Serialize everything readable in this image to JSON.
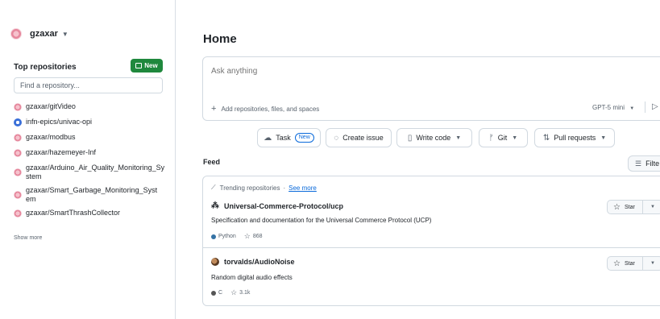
{
  "sidebar": {
    "username": "gzaxar",
    "top_repos_title": "Top repositories",
    "new_button": "New",
    "find_placeholder": "Find a repository...",
    "repos": [
      {
        "name": "gzaxar/gitVideo",
        "avatar": "pink-identicon"
      },
      {
        "name": "infn-epics/univac-opi",
        "avatar": "blue-org-icon"
      },
      {
        "name": "gzaxar/modbus",
        "avatar": "pink-identicon"
      },
      {
        "name": "gzaxar/hazemeyer-Inf",
        "avatar": "pink-identicon"
      },
      {
        "name": "gzaxar/Arduino_Air_Quality_Monitoring_System",
        "avatar": "pink-identicon"
      },
      {
        "name": "gzaxar/Smart_Garbage_Monitoring_System",
        "avatar": "pink-identicon"
      },
      {
        "name": "gzaxar/SmartThrashCollector",
        "avatar": "pink-identicon"
      }
    ],
    "show_more": "Show more"
  },
  "main": {
    "title": "Home",
    "ask_placeholder": "Ask anything",
    "add_repos": "Add repositories, files, and spaces",
    "model": "GPT-5 mini",
    "chips": [
      {
        "label": "Task",
        "badge": "New",
        "icon": "copilot-icon"
      },
      {
        "label": "Create issue",
        "icon": "issue-icon"
      },
      {
        "label": "Write code",
        "icon": "file-icon",
        "dropdown": true
      },
      {
        "label": "Git",
        "icon": "git-branch-icon",
        "dropdown": true
      },
      {
        "label": "Pull requests",
        "icon": "pull-request-icon",
        "dropdown": true
      }
    ],
    "feed_title": "Feed",
    "filter_label": "Filte"
  },
  "feed": {
    "trending_label": "Trending repositories",
    "separator": "·",
    "see_more": "See more",
    "items": [
      {
        "repo": "Universal-Commerce-Protocol/ucp",
        "description": "Specification and documentation for the Universal Commerce Protocol (UCP)",
        "language": "Python",
        "language_color": "#3572A5",
        "stars": "868",
        "star_label": "Star"
      },
      {
        "repo": "torvalds/AudioNoise",
        "description": "Random digital audio effects",
        "language": "C",
        "language_color": "#555555",
        "stars": "3.1k",
        "star_label": "Star"
      }
    ]
  }
}
